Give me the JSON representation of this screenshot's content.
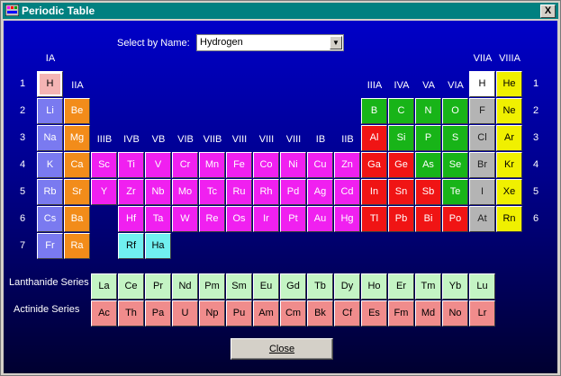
{
  "window": {
    "title": "Periodic Table",
    "close_glyph": "X"
  },
  "selector": {
    "label": "Select  by Name:",
    "value": "Hydrogen",
    "arrow": "▼"
  },
  "close_button": {
    "label": "Close"
  },
  "series_labels": {
    "lanthanide": "Lanthanide Series",
    "actinide": "Actinide Series"
  },
  "colors": {
    "alkali": "#7a7af0",
    "alkaline": "#f28c1a",
    "transition": "#f020f0",
    "transactinide": "#70f0f0",
    "hydrogen": "#f4b4b4",
    "hydrogen_right": "#ffffff",
    "nonmetal_green": "#18b418",
    "metal_red": "#f01414",
    "metalloid_gray": "#b4b4b4",
    "noble": "#f0f000",
    "lanthanide": "#c4f4c4",
    "actinide": "#f08c8c",
    "title_bar": "#008080"
  },
  "group_labels": [
    {
      "text": "IA",
      "col": 0,
      "level": 1
    },
    {
      "text": "IIA",
      "col": 1,
      "level": 2
    },
    {
      "text": "IIIB",
      "col": 2,
      "level": 3
    },
    {
      "text": "IVB",
      "col": 3,
      "level": 3
    },
    {
      "text": "VB",
      "col": 4,
      "level": 3
    },
    {
      "text": "VIB",
      "col": 5,
      "level": 3
    },
    {
      "text": "VIIB",
      "col": 6,
      "level": 3
    },
    {
      "text": "VIII",
      "col": 7,
      "level": 3
    },
    {
      "text": "VIII",
      "col": 8,
      "level": 3
    },
    {
      "text": "VIII",
      "col": 9,
      "level": 3
    },
    {
      "text": "IB",
      "col": 10,
      "level": 3
    },
    {
      "text": "IIB",
      "col": 11,
      "level": 3
    },
    {
      "text": "IIIA",
      "col": 12,
      "level": 2
    },
    {
      "text": "IVA",
      "col": 13,
      "level": 2
    },
    {
      "text": "VA",
      "col": 14,
      "level": 2
    },
    {
      "text": "VIA",
      "col": 15,
      "level": 2
    },
    {
      "text": "VIIA",
      "col": 16,
      "level": 1
    },
    {
      "text": "VIIIA",
      "col": 17,
      "level": 1
    }
  ],
  "period_labels": [
    "1",
    "2",
    "3",
    "4",
    "5",
    "6",
    "7"
  ],
  "elements": [
    {
      "symbol": "H",
      "row": 0,
      "col": 0,
      "type": "hydrogen",
      "selected": true
    },
    {
      "symbol": "H",
      "row": 0,
      "col": 16,
      "type": "hydrogen_right"
    },
    {
      "symbol": "He",
      "row": 0,
      "col": 17,
      "type": "noble"
    },
    {
      "symbol": "Li",
      "row": 1,
      "col": 0,
      "type": "alkali"
    },
    {
      "symbol": "Be",
      "row": 1,
      "col": 1,
      "type": "alkaline"
    },
    {
      "symbol": "B",
      "row": 1,
      "col": 12,
      "type": "nonmetal_green"
    },
    {
      "symbol": "C",
      "row": 1,
      "col": 13,
      "type": "nonmetal_green"
    },
    {
      "symbol": "N",
      "row": 1,
      "col": 14,
      "type": "nonmetal_green"
    },
    {
      "symbol": "O",
      "row": 1,
      "col": 15,
      "type": "nonmetal_green"
    },
    {
      "symbol": "F",
      "row": 1,
      "col": 16,
      "type": "metalloid_gray"
    },
    {
      "symbol": "Ne",
      "row": 1,
      "col": 17,
      "type": "noble"
    },
    {
      "symbol": "Na",
      "row": 2,
      "col": 0,
      "type": "alkali"
    },
    {
      "symbol": "Mg",
      "row": 2,
      "col": 1,
      "type": "alkaline"
    },
    {
      "symbol": "Al",
      "row": 2,
      "col": 12,
      "type": "metal_red"
    },
    {
      "symbol": "Si",
      "row": 2,
      "col": 13,
      "type": "nonmetal_green"
    },
    {
      "symbol": "P",
      "row": 2,
      "col": 14,
      "type": "nonmetal_green"
    },
    {
      "symbol": "S",
      "row": 2,
      "col": 15,
      "type": "nonmetal_green"
    },
    {
      "symbol": "Cl",
      "row": 2,
      "col": 16,
      "type": "metalloid_gray"
    },
    {
      "symbol": "Ar",
      "row": 2,
      "col": 17,
      "type": "noble"
    },
    {
      "symbol": "K",
      "row": 3,
      "col": 0,
      "type": "alkali"
    },
    {
      "symbol": "Ca",
      "row": 3,
      "col": 1,
      "type": "alkaline"
    },
    {
      "symbol": "Sc",
      "row": 3,
      "col": 2,
      "type": "transition"
    },
    {
      "symbol": "Ti",
      "row": 3,
      "col": 3,
      "type": "transition"
    },
    {
      "symbol": "V",
      "row": 3,
      "col": 4,
      "type": "transition"
    },
    {
      "symbol": "Cr",
      "row": 3,
      "col": 5,
      "type": "transition"
    },
    {
      "symbol": "Mn",
      "row": 3,
      "col": 6,
      "type": "transition"
    },
    {
      "symbol": "Fe",
      "row": 3,
      "col": 7,
      "type": "transition"
    },
    {
      "symbol": "Co",
      "row": 3,
      "col": 8,
      "type": "transition"
    },
    {
      "symbol": "Ni",
      "row": 3,
      "col": 9,
      "type": "transition"
    },
    {
      "symbol": "Cu",
      "row": 3,
      "col": 10,
      "type": "transition"
    },
    {
      "symbol": "Zn",
      "row": 3,
      "col": 11,
      "type": "transition"
    },
    {
      "symbol": "Ga",
      "row": 3,
      "col": 12,
      "type": "metal_red"
    },
    {
      "symbol": "Ge",
      "row": 3,
      "col": 13,
      "type": "metal_red"
    },
    {
      "symbol": "As",
      "row": 3,
      "col": 14,
      "type": "nonmetal_green"
    },
    {
      "symbol": "Se",
      "row": 3,
      "col": 15,
      "type": "nonmetal_green"
    },
    {
      "symbol": "Br",
      "row": 3,
      "col": 16,
      "type": "metalloid_gray"
    },
    {
      "symbol": "Kr",
      "row": 3,
      "col": 17,
      "type": "noble"
    },
    {
      "symbol": "Rb",
      "row": 4,
      "col": 0,
      "type": "alkali"
    },
    {
      "symbol": "Sr",
      "row": 4,
      "col": 1,
      "type": "alkaline"
    },
    {
      "symbol": "Y",
      "row": 4,
      "col": 2,
      "type": "transition"
    },
    {
      "symbol": "Zr",
      "row": 4,
      "col": 3,
      "type": "transition"
    },
    {
      "symbol": "Nb",
      "row": 4,
      "col": 4,
      "type": "transition"
    },
    {
      "symbol": "Mo",
      "row": 4,
      "col": 5,
      "type": "transition"
    },
    {
      "symbol": "Tc",
      "row": 4,
      "col": 6,
      "type": "transition"
    },
    {
      "symbol": "Ru",
      "row": 4,
      "col": 7,
      "type": "transition"
    },
    {
      "symbol": "Rh",
      "row": 4,
      "col": 8,
      "type": "transition"
    },
    {
      "symbol": "Pd",
      "row": 4,
      "col": 9,
      "type": "transition"
    },
    {
      "symbol": "Ag",
      "row": 4,
      "col": 10,
      "type": "transition"
    },
    {
      "symbol": "Cd",
      "row": 4,
      "col": 11,
      "type": "transition"
    },
    {
      "symbol": "In",
      "row": 4,
      "col": 12,
      "type": "metal_red"
    },
    {
      "symbol": "Sn",
      "row": 4,
      "col": 13,
      "type": "metal_red"
    },
    {
      "symbol": "Sb",
      "row": 4,
      "col": 14,
      "type": "metal_red"
    },
    {
      "symbol": "Te",
      "row": 4,
      "col": 15,
      "type": "nonmetal_green"
    },
    {
      "symbol": "I",
      "row": 4,
      "col": 16,
      "type": "metalloid_gray"
    },
    {
      "symbol": "Xe",
      "row": 4,
      "col": 17,
      "type": "noble"
    },
    {
      "symbol": "Cs",
      "row": 5,
      "col": 0,
      "type": "alkali"
    },
    {
      "symbol": "Ba",
      "row": 5,
      "col": 1,
      "type": "alkaline"
    },
    {
      "symbol": "Hf",
      "row": 5,
      "col": 3,
      "type": "transition"
    },
    {
      "symbol": "Ta",
      "row": 5,
      "col": 4,
      "type": "transition"
    },
    {
      "symbol": "W",
      "row": 5,
      "col": 5,
      "type": "transition"
    },
    {
      "symbol": "Re",
      "row": 5,
      "col": 6,
      "type": "transition"
    },
    {
      "symbol": "Os",
      "row": 5,
      "col": 7,
      "type": "transition"
    },
    {
      "symbol": "Ir",
      "row": 5,
      "col": 8,
      "type": "transition"
    },
    {
      "symbol": "Pt",
      "row": 5,
      "col": 9,
      "type": "transition"
    },
    {
      "symbol": "Au",
      "row": 5,
      "col": 10,
      "type": "transition"
    },
    {
      "symbol": "Hg",
      "row": 5,
      "col": 11,
      "type": "transition"
    },
    {
      "symbol": "Tl",
      "row": 5,
      "col": 12,
      "type": "metal_red"
    },
    {
      "symbol": "Pb",
      "row": 5,
      "col": 13,
      "type": "metal_red"
    },
    {
      "symbol": "Bi",
      "row": 5,
      "col": 14,
      "type": "metal_red"
    },
    {
      "symbol": "Po",
      "row": 5,
      "col": 15,
      "type": "metal_red"
    },
    {
      "symbol": "At",
      "row": 5,
      "col": 16,
      "type": "metalloid_gray"
    },
    {
      "symbol": "Rn",
      "row": 5,
      "col": 17,
      "type": "noble"
    },
    {
      "symbol": "Fr",
      "row": 6,
      "col": 0,
      "type": "alkali"
    },
    {
      "symbol": "Ra",
      "row": 6,
      "col": 1,
      "type": "alkaline"
    },
    {
      "symbol": "Rf",
      "row": 6,
      "col": 3,
      "type": "transactinide"
    },
    {
      "symbol": "Ha",
      "row": 6,
      "col": 4,
      "type": "transactinide"
    }
  ],
  "lanthanides": [
    "La",
    "Ce",
    "Pr",
    "Nd",
    "Pm",
    "Sm",
    "Eu",
    "Gd",
    "Tb",
    "Dy",
    "Ho",
    "Er",
    "Tm",
    "Yb",
    "Lu"
  ],
  "actinides": [
    "Ac",
    "Th",
    "Pa",
    "U",
    "Np",
    "Pu",
    "Am",
    "Cm",
    "Bk",
    "Cf",
    "Es",
    "Fm",
    "Md",
    "No",
    "Lr"
  ]
}
